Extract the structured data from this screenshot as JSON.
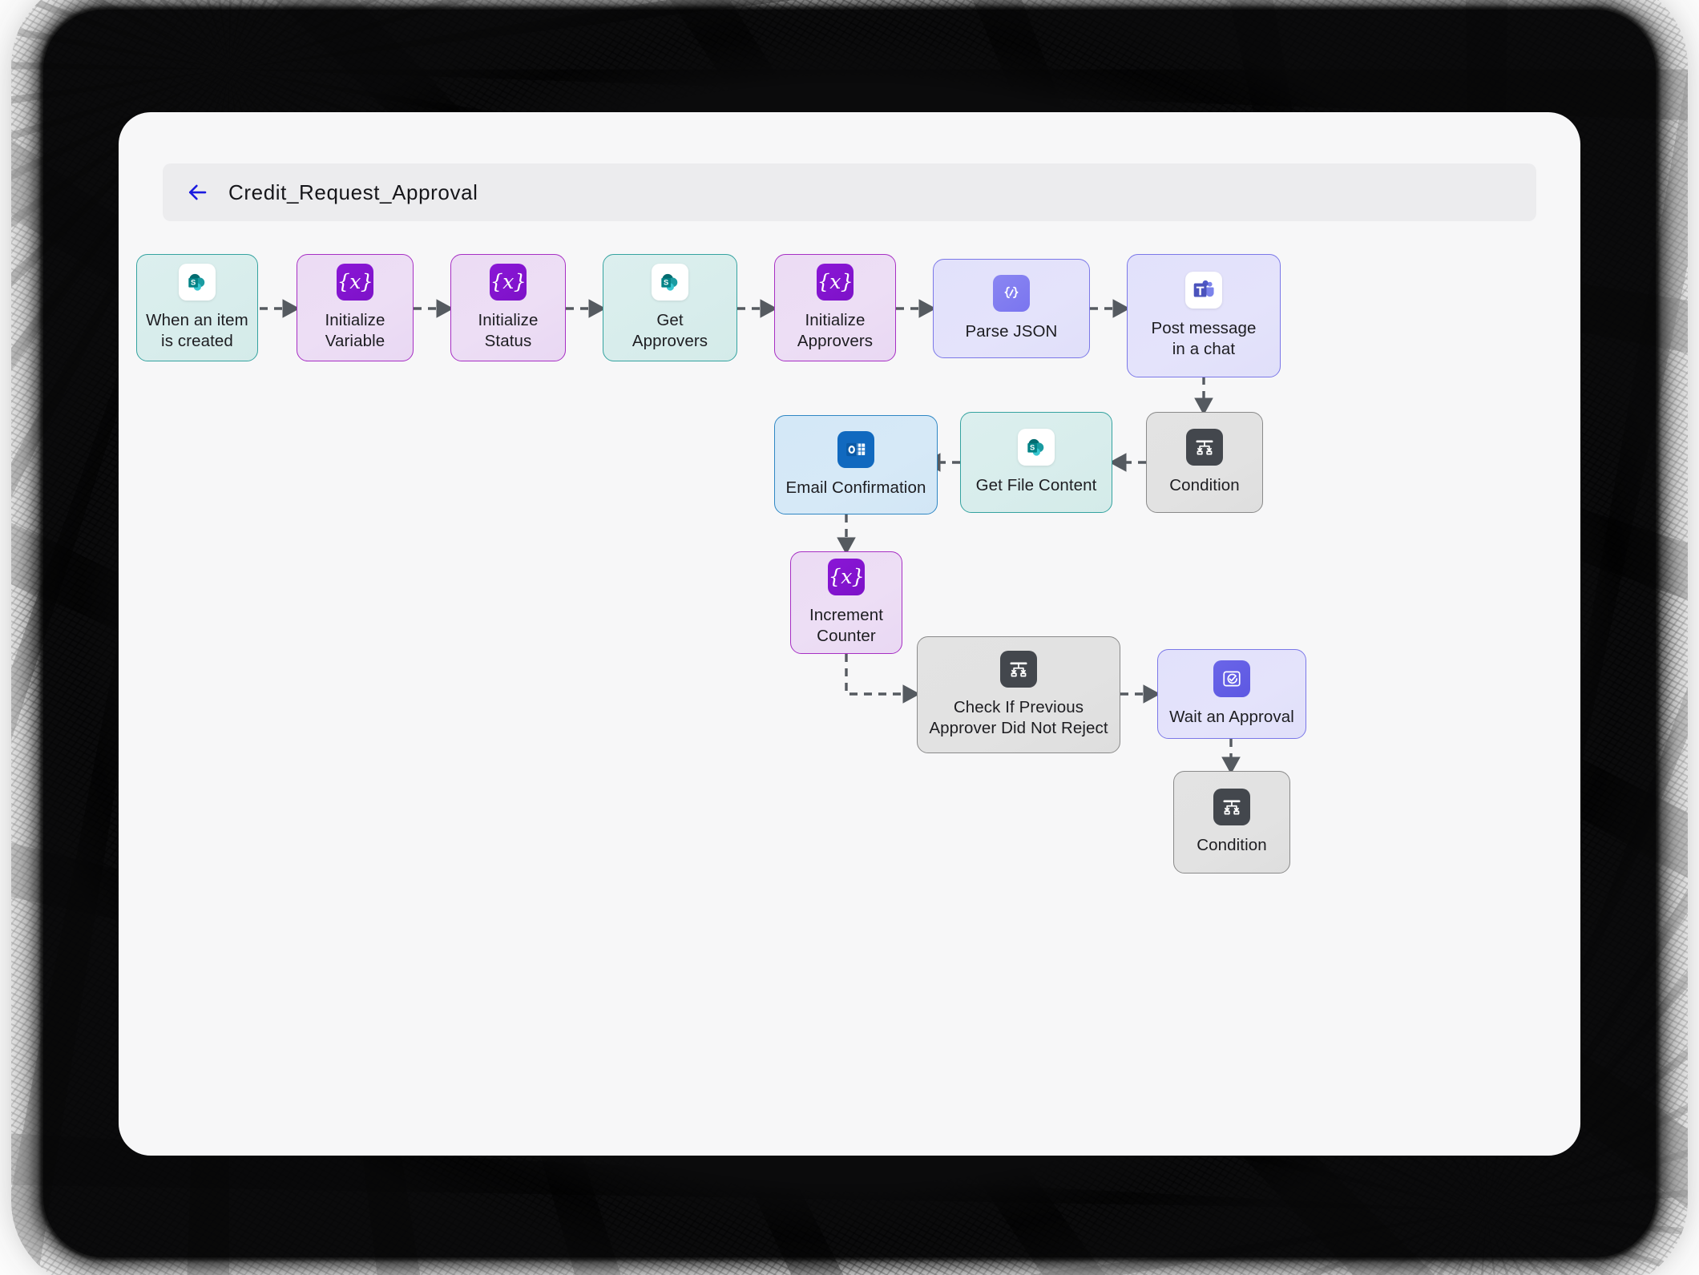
{
  "window": {
    "app_surface": "flow-designer-canvas"
  },
  "header": {
    "back_icon": "back-arrow-icon",
    "title": "Credit_Request_Approval"
  },
  "colors": {
    "accent_blue": "#1a1ae0",
    "teal_border": "#35a3a0",
    "purple_border": "#a72fc4",
    "indigo_border": "#7b78e8",
    "blue_border": "#2f87c4",
    "gray_border": "#8a8a8a",
    "canvas_bg": "#f7f7f8",
    "header_bg": "#ececee",
    "edge_stroke": "#555a60",
    "variable_tile": "#8a16d6",
    "outlook_tile": "#1169bf",
    "condition_tile": "#43474d"
  },
  "nodes": [
    {
      "id": "when-item-created",
      "label": "When an item\nis created",
      "icon": "sharepoint-icon",
      "theme": "teal"
    },
    {
      "id": "initialize-variable",
      "label": "Initialize\nVariable",
      "icon": "variable-icon",
      "theme": "purple"
    },
    {
      "id": "initialize-status",
      "label": "Initialize\nStatus",
      "icon": "variable-icon",
      "theme": "purple"
    },
    {
      "id": "get-approvers",
      "label": "Get\nApprovers",
      "icon": "sharepoint-icon",
      "theme": "teal"
    },
    {
      "id": "initialize-approvers",
      "label": "Initialize\nApprovers",
      "icon": "variable-icon",
      "theme": "purple"
    },
    {
      "id": "parse-json",
      "label": "Parse JSON",
      "icon": "parse-json-icon",
      "theme": "indigo"
    },
    {
      "id": "post-message-chat",
      "label": "Post message\nin a chat",
      "icon": "teams-icon",
      "theme": "indigo"
    },
    {
      "id": "condition-1",
      "label": "Condition",
      "icon": "condition-icon",
      "theme": "gray"
    },
    {
      "id": "get-file-content",
      "label": "Get File Content",
      "icon": "sharepoint-icon",
      "theme": "teal"
    },
    {
      "id": "email-confirmation",
      "label": "Email Confirmation",
      "icon": "outlook-icon",
      "theme": "blue"
    },
    {
      "id": "increment-counter",
      "label": "Increment\nCounter",
      "icon": "variable-icon",
      "theme": "purple"
    },
    {
      "id": "check-previous-approver",
      "label": "Check If Previous\nApprover Did Not Reject",
      "icon": "condition-icon",
      "theme": "gray"
    },
    {
      "id": "wait-an-approval",
      "label": "Wait an Approval",
      "icon": "approval-icon",
      "theme": "indigo"
    },
    {
      "id": "condition-2",
      "label": "Condition",
      "icon": "condition-icon",
      "theme": "gray"
    }
  ],
  "edges": [
    {
      "from": "when-item-created",
      "to": "initialize-variable",
      "style": "dashed",
      "direction": "right"
    },
    {
      "from": "initialize-variable",
      "to": "initialize-status",
      "style": "dashed",
      "direction": "right"
    },
    {
      "from": "initialize-status",
      "to": "get-approvers",
      "style": "dashed",
      "direction": "right"
    },
    {
      "from": "get-approvers",
      "to": "initialize-approvers",
      "style": "dashed",
      "direction": "right"
    },
    {
      "from": "initialize-approvers",
      "to": "parse-json",
      "style": "dashed",
      "direction": "right"
    },
    {
      "from": "parse-json",
      "to": "post-message-chat",
      "style": "dashed",
      "direction": "right"
    },
    {
      "from": "post-message-chat",
      "to": "condition-1",
      "style": "dashed",
      "direction": "down"
    },
    {
      "from": "condition-1",
      "to": "get-file-content",
      "style": "dashed",
      "direction": "left"
    },
    {
      "from": "get-file-content",
      "to": "email-confirmation",
      "style": "dashed",
      "direction": "left"
    },
    {
      "from": "email-confirmation",
      "to": "increment-counter",
      "style": "dashed",
      "direction": "down"
    },
    {
      "from": "increment-counter",
      "to": "check-previous-approver",
      "style": "dashed",
      "direction": "elbow-down-right"
    },
    {
      "from": "check-previous-approver",
      "to": "wait-an-approval",
      "style": "dashed",
      "direction": "right"
    },
    {
      "from": "wait-an-approval",
      "to": "condition-2",
      "style": "dashed",
      "direction": "down"
    }
  ]
}
